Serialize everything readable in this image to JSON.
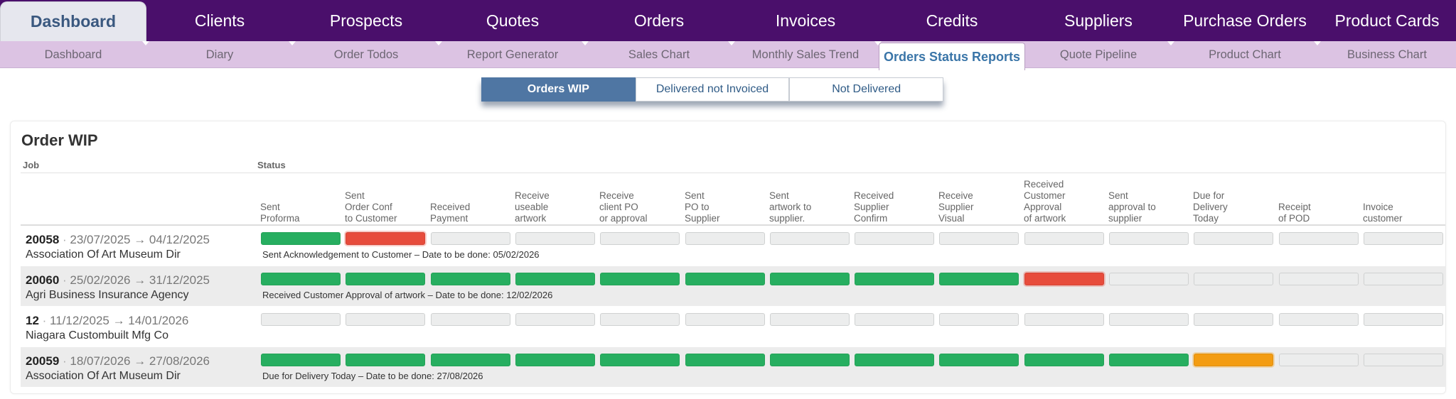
{
  "top_nav": {
    "tabs": [
      "Dashboard",
      "Clients",
      "Prospects",
      "Quotes",
      "Orders",
      "Invoices",
      "Credits",
      "Suppliers",
      "Purchase Orders",
      "Product Cards"
    ],
    "active_index": 0
  },
  "sub_nav": {
    "tabs": [
      "Dashboard",
      "Diary",
      "Order Todos",
      "Report Generator",
      "Sales Chart",
      "Monthly Sales Trend",
      "Orders Status Reports",
      "Quote Pipeline",
      "Product Chart",
      "Business Chart"
    ],
    "active_index": 6
  },
  "report_toggle": {
    "buttons": [
      "Orders WIP",
      "Delivered not Invoiced",
      "Not Delivered"
    ],
    "active_index": 0
  },
  "card": {
    "title": "Order WIP",
    "job_header": "Job",
    "status_header": "Status",
    "status_columns": [
      "Sent\nProforma",
      "Sent\nOrder Conf\nto Customer",
      "Received\nPayment",
      "Receive\nuseable\nartwork",
      "Receive\nclient PO\nor approval",
      "Sent\nPO to\nSupplier",
      "Sent\nartwork to\nsupplier.",
      "Received\nSupplier\nConfirm",
      "Receive\nSupplier\nVisual",
      "Received\nCustomer\nApproval\nof artwork",
      "Sent\napproval to\nsupplier",
      "Due for\nDelivery\nToday",
      "Receipt\nof POD",
      "Invoice\ncustomer"
    ],
    "rows": [
      {
        "job_number": "20058",
        "dates": "23/07/2025 → 04/12/2025",
        "client": "Association Of Art Museum Dir",
        "statuses": [
          "done",
          "late",
          "pending",
          "pending",
          "pending",
          "pending",
          "pending",
          "pending",
          "pending",
          "pending",
          "pending",
          "pending",
          "pending",
          "pending"
        ],
        "note": "Sent Acknowledgement to Customer – Date to be done: 05/02/2026"
      },
      {
        "job_number": "20060",
        "dates": "25/02/2026 → 31/12/2025",
        "client": "Agri Business Insurance Agency",
        "statuses": [
          "done",
          "done",
          "done",
          "done",
          "done",
          "done",
          "done",
          "done",
          "done",
          "late",
          "pending",
          "pending",
          "pending",
          "pending"
        ],
        "note": "Received Customer Approval of artwork – Date to be done: 12/02/2026"
      },
      {
        "job_number": "12",
        "dates": "11/12/2025 → 14/01/2026",
        "client": "Niagara Custombuilt Mfg Co",
        "statuses": [
          "pending",
          "pending",
          "pending",
          "pending",
          "pending",
          "pending",
          "pending",
          "pending",
          "pending",
          "pending",
          "pending",
          "pending",
          "pending",
          "pending"
        ],
        "note": ""
      },
      {
        "job_number": "20059",
        "dates": "18/07/2026 → 27/08/2026",
        "client": "Association Of Art Museum Dir",
        "statuses": [
          "done",
          "done",
          "done",
          "done",
          "done",
          "done",
          "done",
          "done",
          "done",
          "done",
          "done",
          "due",
          "pending",
          "pending"
        ],
        "note": "Due for Delivery Today – Date to be done: 27/08/2026"
      }
    ]
  },
  "colors": {
    "top_nav_bg": "#4a0f6b",
    "sub_nav_bg": "#dcc3e3",
    "done": "#27ae60",
    "late": "#e74c3c",
    "due": "#f39c12",
    "pending": "#eceded",
    "toggle_active": "#4f76a3"
  }
}
